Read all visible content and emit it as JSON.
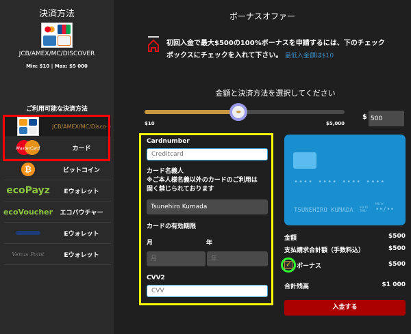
{
  "sidebar": {
    "title": "決済方法",
    "method_name": "JCB/AMEX/MC/DISCOVER",
    "limits": "Min: $10 | Max: $5 000",
    "available_title": "ご利用可能な決済方法",
    "items": [
      {
        "label": "JCB/AMEX/MC/Disco···",
        "icon": "card-brands-icon",
        "selected": true
      },
      {
        "label": "カード",
        "icon": "mastercard-icon"
      },
      {
        "label": "ビットコイン",
        "icon": "bitcoin-icon"
      },
      {
        "label": "Eウォレット",
        "icon": "ecopayz-logo",
        "logo_text": "ecoPayz"
      },
      {
        "label": "エコバウチャー",
        "icon": "ecovoucher-logo",
        "logo_text": "ecoVoucher"
      },
      {
        "label": "Eウォレット",
        "icon": "ewallet-logo"
      },
      {
        "label": "Eウォレット",
        "icon": "venuspoint-logo",
        "logo_text": "Venus Point"
      }
    ]
  },
  "main": {
    "title": "ボーナスオファー",
    "bonus_text_1": "初回入金で最大$500の100%ボーナスを申請するには、下のチェック",
    "bonus_text_2": "ボックスにチェックを入れて下さい。",
    "min_deposit": "最低入金額は$10",
    "select_prompt": "金額と決済方法を選択してください",
    "slider": {
      "min_label": "$10",
      "max_label": "$5,000",
      "min": 10,
      "max": 5000,
      "value": 500,
      "fill_color": "#c8963e"
    },
    "amount": {
      "currency": "$",
      "value": "500"
    }
  },
  "form": {
    "cardnumber_label": "Cardnumber",
    "cardnumber_placeholder": "Creditcard",
    "holder_label_1": "カード名義人",
    "holder_label_2": "※ご本人様名義以外のカードのご利用は",
    "holder_label_3": "固く禁じられております",
    "holder_value": "Tsunehiro Kumada",
    "expiry_label": "カードの有効期限",
    "month_label": "月",
    "year_label": "年",
    "month_placeholder": "月",
    "year_placeholder": "年",
    "cvv_label": "CVV2",
    "cvv_placeholder": "CVV"
  },
  "card": {
    "number": "•••• •••• •••• ••••",
    "holder": "TSUNEHIRO KUMADA",
    "valid_label": "VALID THRU",
    "mmyy_label": "MM/YY",
    "expiry": "••/••",
    "color": "#1a8fd0"
  },
  "summary": {
    "amount_label": "金額",
    "amount_value": "$500",
    "total_label": "支払請求合計額（手数料込）",
    "total_value": "$500",
    "bonus_label": "ボーナス",
    "bonus_value": "$500",
    "bonus_checked": true,
    "balance_label": "合計残高",
    "balance_value": "$1 000",
    "deposit_button": "入金する"
  }
}
